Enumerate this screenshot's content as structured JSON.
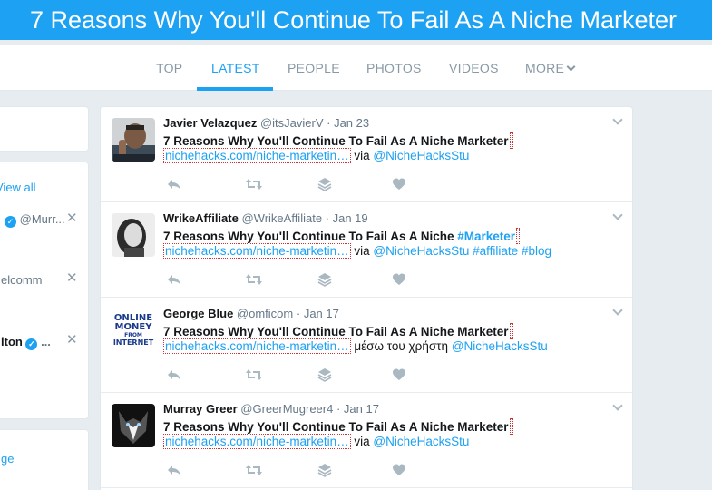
{
  "page": {
    "title": "7 Reasons Why You'll Continue To Fail As A Niche Marketer"
  },
  "nav": {
    "tabs": [
      {
        "label": "TOP"
      },
      {
        "label": "LATEST"
      },
      {
        "label": "PEOPLE"
      },
      {
        "label": "PHOTOS"
      },
      {
        "label": "VIDEOS"
      },
      {
        "label": "MORE"
      }
    ]
  },
  "sidebar": {
    "view_all": "View all",
    "suggest1_handle": "@Murr...",
    "suggest2_name": "elcomm",
    "suggest3_name": "lton",
    "suggest3_more": "...",
    "bottom_link": "ge"
  },
  "tweets": [
    {
      "name": "Javier Velazquez",
      "handle": "@itsJavierV",
      "date": "· Jan 23",
      "text": "7 Reasons Why You'll Continue To Fail As A Niche Marketer",
      "hashtag": "",
      "link": "nichehacks.com/niche-marketin…",
      "via": "via",
      "mention": "@NicheHacksStu",
      "extra": ""
    },
    {
      "name": "WrikeAffiliate",
      "handle": "@WrikeAffiliate",
      "date": "· Jan 19",
      "text": "7 Reasons Why You'll Continue To Fail As A Niche ",
      "hashtag": "#Marketer",
      "link": "nichehacks.com/niche-marketin…",
      "via": "via",
      "mention": "@NicheHacksStu",
      "extra": "#affiliate #blog"
    },
    {
      "name": "George Blue",
      "handle": "@omficom",
      "date": "· Jan 17",
      "text": "7 Reasons Why You'll Continue To Fail As A Niche Marketer",
      "hashtag": "",
      "link": "nichehacks.com/niche-marketin…",
      "via": "μέσω του χρήστη",
      "mention": "@NicheHacksStu",
      "extra": ""
    },
    {
      "name": "Murray Greer",
      "handle": "@GreerMugreer4",
      "date": "· Jan 17",
      "text": "7 Reasons Why You'll Continue To Fail As A Niche Marketer",
      "hashtag": "",
      "link": "nichehacks.com/niche-marketin…",
      "via": "via",
      "mention": "@NicheHacksStu",
      "extra": ""
    }
  ],
  "avatar3_text": [
    "ONLINE",
    "MONEY",
    "FROM",
    "INTERNET"
  ],
  "icons": {
    "reply": "reply-icon",
    "retweet": "retweet-icon",
    "stack": "layers-icon",
    "like": "heart-icon",
    "caret": "chevron-down-icon"
  },
  "colors": {
    "brand": "#1da1f2",
    "text": "#14171a",
    "muted": "#657786"
  }
}
